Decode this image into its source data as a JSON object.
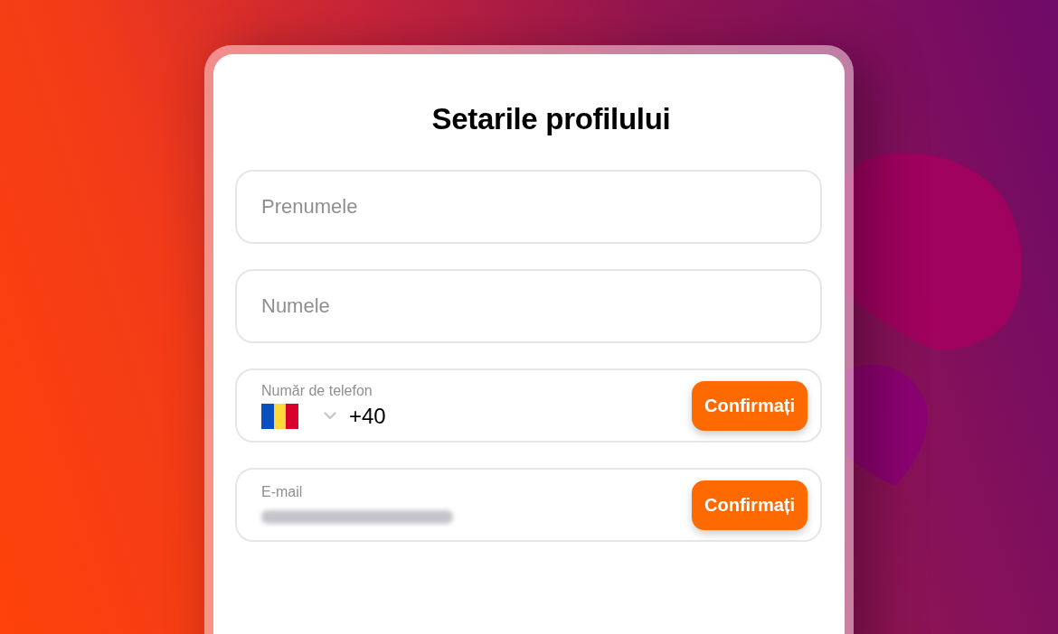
{
  "title": "Setarile profilului",
  "fields": [
    {
      "kind": "text",
      "placeholder": "Prenumele"
    },
    {
      "kind": "text",
      "placeholder": "Numele"
    },
    {
      "kind": "phone",
      "label": "Număr de telefon",
      "prefix": "+40",
      "button": "Confirmați"
    },
    {
      "kind": "email",
      "label": "E-mail",
      "button": "Confirmați"
    }
  ]
}
